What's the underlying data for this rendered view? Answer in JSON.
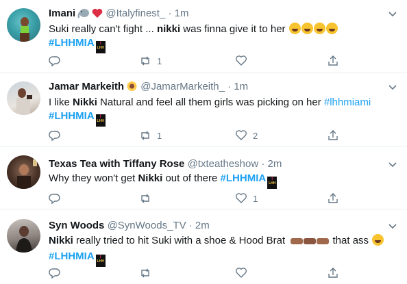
{
  "tweets": [
    {
      "name": "Imani",
      "name_emojis": [
        "elephant-emoji",
        "red-heart-emoji"
      ],
      "handle": "@Italyfinest_",
      "dot": "·",
      "time": "1m",
      "text_1": "Suki really can't fight ... ",
      "text_bold": "nikki",
      "text_2": " was finna give it to her ",
      "hashtag": "#LHHMIA",
      "reply_count": "",
      "retweet_count": "1",
      "like_count": ""
    },
    {
      "name": "Jamar Markeith",
      "name_emojis": [
        "sunflower-emoji"
      ],
      "handle": "@JamarMarkeith_",
      "dot": "·",
      "time": "1m",
      "text_1": "I like ",
      "text_bold": "Nikki",
      "text_2": " Natural and feel all them girls was picking on her ",
      "inline_hashtag": "#lhhmiami",
      "hashtag": "#LHHMIA",
      "reply_count": "",
      "retweet_count": "1",
      "like_count": "2"
    },
    {
      "name": "Texas Tea with Tiffany Rose",
      "handle": "@txteatheshow",
      "dot": "·",
      "time": "2m",
      "text_1": "Why they won't get ",
      "text_bold": "Nikki",
      "text_2": " out of there  ",
      "hashtag": "#LHHMIA",
      "reply_count": "",
      "retweet_count": "",
      "like_count": "1"
    },
    {
      "name": "Syn Woods",
      "handle": "@SynWoods_TV",
      "dot": "·",
      "time": "2m",
      "text_bold": "Nikki",
      "text_2": " really tried to hit Suki with a shoe & Hood Brat ",
      "text_3": " that ass ",
      "hashtag": "#LHHMIA",
      "reply_count": "",
      "retweet_count": "",
      "like_count": ""
    }
  ],
  "lhh_badge": {
    "line1": "I",
    "line2": "LHH"
  },
  "colors": {
    "link": "#1da1f2",
    "muted": "#657786",
    "divider": "#e6ecf0",
    "text": "#14171a"
  }
}
